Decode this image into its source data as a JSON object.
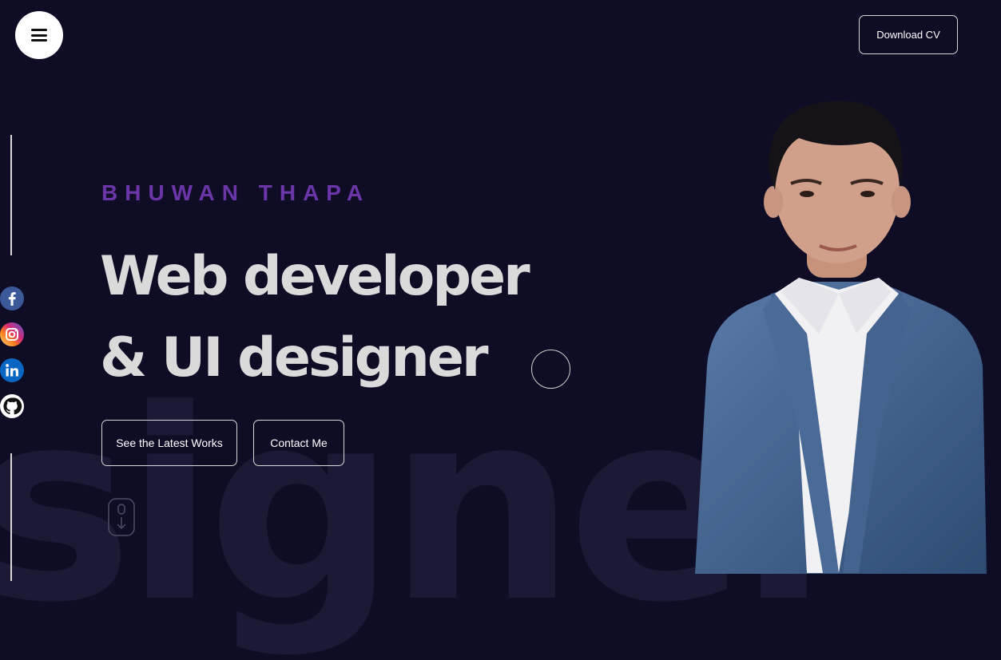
{
  "header": {
    "menu_icon": "hamburger-menu-icon",
    "download_cv_label": "Download CV"
  },
  "social": [
    {
      "name": "facebook",
      "icon": "facebook-icon",
      "color": "#3b5998"
    },
    {
      "name": "instagram",
      "icon": "instagram-icon",
      "color": "#d62976"
    },
    {
      "name": "linkedin",
      "icon": "linkedin-icon",
      "color": "#0a66c2"
    },
    {
      "name": "github",
      "icon": "github-icon",
      "color": "#111111"
    }
  ],
  "hero": {
    "name": "BHUWAN THAPA",
    "headline_line1": "Web developer",
    "headline_line2": "& UI designer",
    "works_button": "See the Latest Works",
    "contact_button": "Contact Me",
    "background_word": "signer",
    "scroll_icon": "mouse-scroll-icon"
  },
  "colors": {
    "background": "#0f0d26",
    "accent_purple": "#6b35a8",
    "headline": "#dadada"
  }
}
